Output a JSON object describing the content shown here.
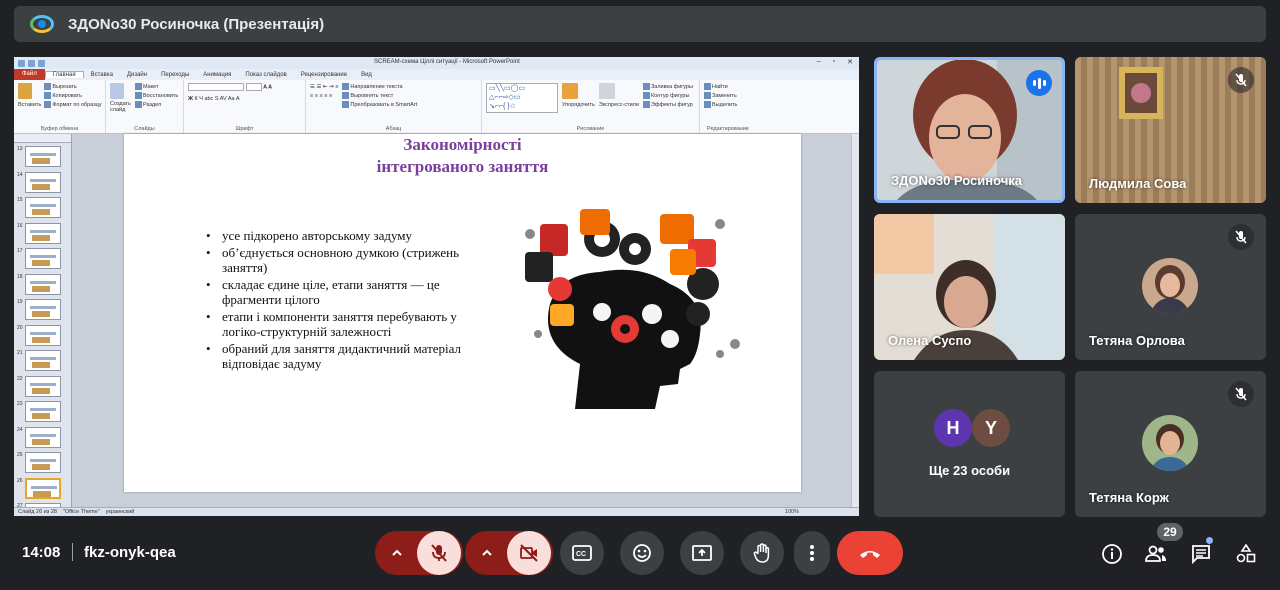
{
  "meeting": {
    "title": "ЗДОNo30 Росиночка (Презентація)",
    "time": "14:08",
    "code": "fkz-onyk-qea",
    "participants_badge": "29"
  },
  "powerpoint": {
    "document_title": "SCREAM-схема Ціллі ситуації - Microsoft PowerPoint",
    "tabs": [
      "Файл",
      "Главная",
      "Вставка",
      "Дизайн",
      "Переходы",
      "Анимация",
      "Показ слайдов",
      "Рецензирование",
      "Вид"
    ],
    "active_tab": "Главная",
    "ribbon_groups": {
      "clipboard": {
        "label": "Буфер обмена",
        "paste": "Вставить",
        "cut": "Вырезать",
        "copy": "Копировать",
        "format": "Формат по образцу"
      },
      "slides": {
        "label": "Слайды",
        "create": "Создать слайд",
        "layout": "Макет",
        "reset": "Восстановить",
        "section": "Раздел"
      },
      "font": {
        "label": "Шрифт"
      },
      "paragraph": {
        "label": "Абзац",
        "direction": "Направление текста",
        "align": "Выровнять текст",
        "smartart": "Преобразовать в SmartArt"
      },
      "drawing": {
        "label": "Рисование",
        "arrange": "Упорядочить",
        "styles": "Экспресс-стили",
        "fill": "Заливка фигуры",
        "outline": "Контур фигуры",
        "effects": "Эффекты фигур"
      },
      "editing": {
        "label": "Редактирование",
        "find": "Найти",
        "replace": "Заменить",
        "select": "Выделить"
      }
    },
    "slide_numbers": [
      "13",
      "14",
      "15",
      "16",
      "17",
      "18",
      "19",
      "20",
      "21",
      "22",
      "23",
      "24",
      "25",
      "26",
      "27",
      "28"
    ],
    "selected_slide": "26",
    "status": {
      "slide": "Слайд 26 из 28",
      "theme": "\"Office Theme\"",
      "lang": "украинский",
      "zoom": "100%"
    }
  },
  "slide": {
    "title_line1": "Закономірності",
    "title_line2": "інтегрованого   заняття",
    "bullets": [
      "усе підкорено авторському задуму",
      "об’єднується основною думкою (стрижень заняття)",
      "складає єдине ціле, етапи заняття — це фрагменти цілого",
      "етапи і компоненти заняття перебувають у логіко-структурній залежності",
      "обраний для заняття дидактичний матеріал відповідає задуму"
    ]
  },
  "participants": [
    {
      "name": "ЗДОNo30 Росиночка",
      "state": "speaking"
    },
    {
      "name": "Людмила Сова",
      "state": "muted"
    },
    {
      "name": "Олена Суспо",
      "state": "video"
    },
    {
      "name": "Тетяна Орлова",
      "state": "muted"
    },
    {
      "name": "Тетяна Корж",
      "state": "muted"
    }
  ],
  "others": {
    "label": "Ще 23 особи",
    "initials": [
      "H",
      "Y"
    ],
    "colors": [
      "#5e35b1",
      "#6d4c41"
    ]
  },
  "colors": {
    "background": "#202124",
    "panel": "#3c4043",
    "end_call": "#ea4335",
    "muted_control": "#f9dedc",
    "accent": "#8ab4f8"
  }
}
